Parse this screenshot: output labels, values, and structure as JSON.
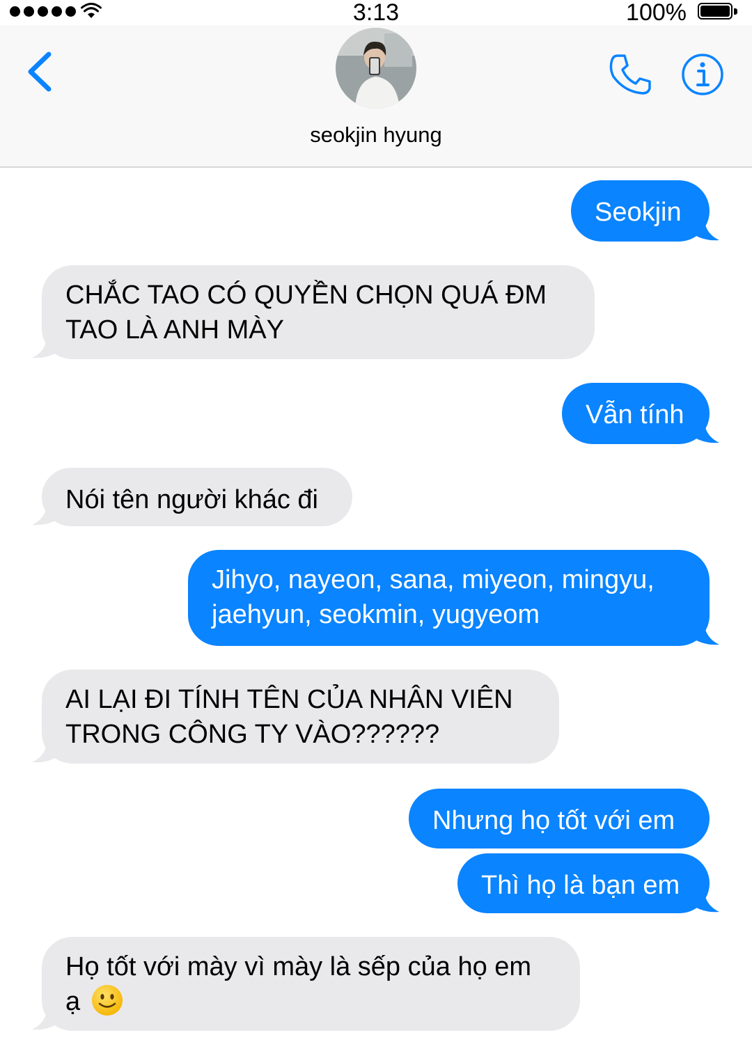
{
  "status_bar": {
    "time": "3:13",
    "battery": "100%",
    "signal_bars": 5
  },
  "header": {
    "contact_name": "seokjin hyung",
    "back_icon": "chevron-left-icon",
    "call_icon": "phone-icon",
    "info_icon": "info-icon",
    "accent_color": "#0a84ff"
  },
  "messages": [
    {
      "from": "me",
      "text": "Seokjin"
    },
    {
      "from": "them",
      "lines": [
        "CHẮC TAO CÓ QUYỀN CHỌN QUÁ ĐM",
        "TAO LÀ ANH MÀY"
      ]
    },
    {
      "from": "me",
      "text": "Vẫn tính"
    },
    {
      "from": "them",
      "text": "Nói tên người khác đi"
    },
    {
      "from": "me",
      "lines": [
        "Jihyo, nayeon, sana, miyeon, mingyu,",
        "jaehyun, seokmin, yugyeom"
      ]
    },
    {
      "from": "them",
      "lines": [
        "AI LẠI ĐI TÍNH TÊN CỦA NHÂN VIÊN",
        "TRONG CÔNG TY VÀO??????"
      ]
    },
    {
      "from": "me",
      "text": "Nhưng họ tốt với em"
    },
    {
      "from": "me",
      "text": "Thì họ là bạn em"
    },
    {
      "from": "them",
      "lines": [
        "Họ tốt với mày vì mày là sếp của họ em",
        "ạ"
      ],
      "emoji": "slightly-smiling-face-icon"
    }
  ],
  "colors": {
    "outgoing_bubble": "#0a84ff",
    "incoming_bubble": "#e9e9eb"
  }
}
